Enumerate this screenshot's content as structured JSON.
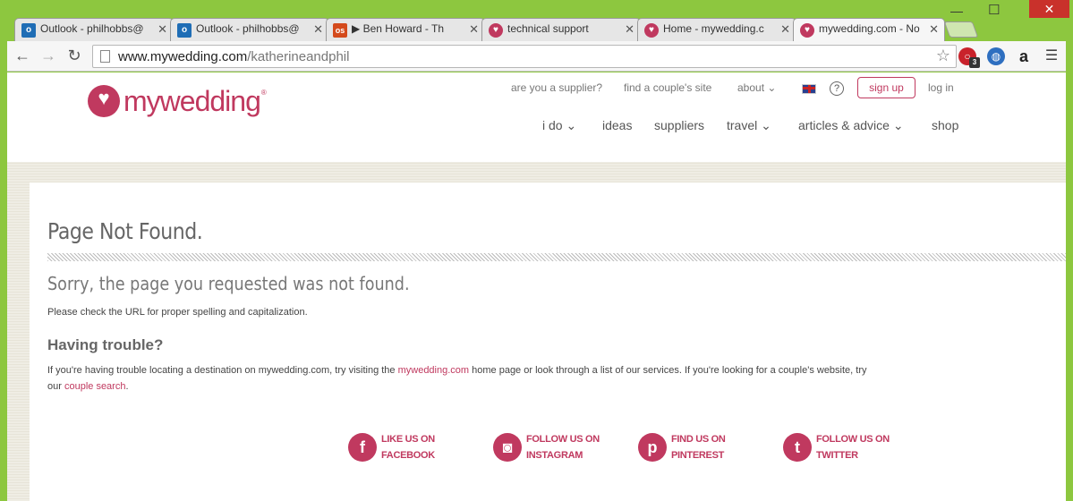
{
  "browser": {
    "tabs": [
      {
        "title": "Outlook - philhobbs@",
        "icon": "outlook-icon",
        "icon_color": "#1f6db5",
        "icon_glyph": "o"
      },
      {
        "title": "Outlook - philhobbs@",
        "icon": "outlook-icon",
        "icon_color": "#1f6db5",
        "icon_glyph": "o"
      },
      {
        "title": "▶ Ben Howard - Th",
        "icon": "lastfm-icon",
        "icon_color": "#d44a1c",
        "icon_glyph": "os"
      },
      {
        "title": "technical support",
        "icon": "heart-icon",
        "icon_color": "#c0395f",
        "icon_glyph": "♥"
      },
      {
        "title": "Home - mywedding.c",
        "icon": "heart-icon",
        "icon_color": "#c0395f",
        "icon_glyph": "♥"
      },
      {
        "title": "mywedding.com - No",
        "icon": "heart-icon",
        "icon_color": "#c0395f",
        "icon_glyph": "♥"
      }
    ],
    "url_host": "www.mywedding.com",
    "url_path": "/katherineandphil",
    "ext_badge": "3"
  },
  "site": {
    "logo_text": "mywedding",
    "logo_mark": "®",
    "top_links": {
      "supplier": "are you a supplier?",
      "find_couple": "find a couple's site",
      "about": "about",
      "help": "?",
      "signup": "sign up",
      "login": "log in"
    },
    "nav": {
      "i_do": "i do",
      "ideas": "ideas",
      "suppliers": "suppliers",
      "travel": "travel",
      "articles": "articles & advice",
      "shop": "shop"
    }
  },
  "content": {
    "title": "Page Not Found.",
    "sorry": "Sorry, the page you requested was not found.",
    "check": "Please check the URL for proper spelling and capitalization.",
    "trouble_heading": "Having trouble?",
    "para_1": "If you're having trouble locating a destination on mywedding.com, try visiting the ",
    "para_link_1": "mywedding.com",
    "para_2": " home page or look through a list of our services. If you're looking for a couple's website, try our ",
    "para_link_2": "couple search",
    "para_3": "."
  },
  "social": {
    "facebook": {
      "line1": "LIKE US ON",
      "line2": "FACEBOOK",
      "glyph": "f"
    },
    "instagram": {
      "line1": "FOLLOW US ON",
      "line2": "INSTAGRAM",
      "glyph": "◙"
    },
    "pinterest": {
      "line1": "FIND US ON",
      "line2": "PINTEREST",
      "glyph": "p"
    },
    "twitter": {
      "line1": "FOLLOW US ON",
      "line2": "TWITTER",
      "glyph": "t"
    }
  },
  "colors": {
    "brand": "#c0395f",
    "frame": "#8dc73f"
  }
}
